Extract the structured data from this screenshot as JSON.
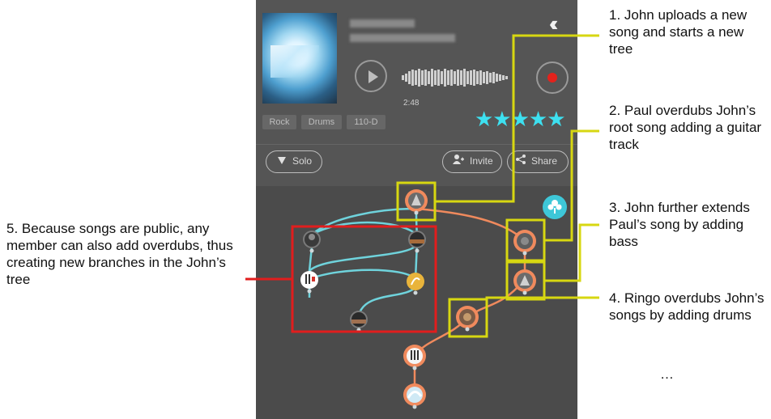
{
  "player": {
    "back_icon": "double-chevron-left-icon",
    "time": "2:48",
    "tags": [
      "Rock",
      "Drums",
      "110-D"
    ],
    "rating": 5,
    "play_icon": "play-icon",
    "record_icon": "record-icon",
    "solo_label": "Solo",
    "invite_label": "Invite",
    "share_label": "Share",
    "tree_button_icon": "tree-icon"
  },
  "annotations": [
    "1. John uploads a new song and starts a new tree",
    "2. Paul overdubs John’s root song adding a guitar track",
    "3. John further extends Paul’s song by adding bass",
    "4. Ringo overdubs John’s songs by adding drums",
    "…",
    "5. Because songs are public, any member can also add overdubs, thus creating new branches in the John’s tree"
  ],
  "colors": {
    "highlight_yellow": "#d7d711",
    "highlight_red": "#e11d1d",
    "branch_orange": "#f08a5d",
    "branch_teal": "#6fd3dc",
    "star_cyan": "#3de0f0"
  }
}
